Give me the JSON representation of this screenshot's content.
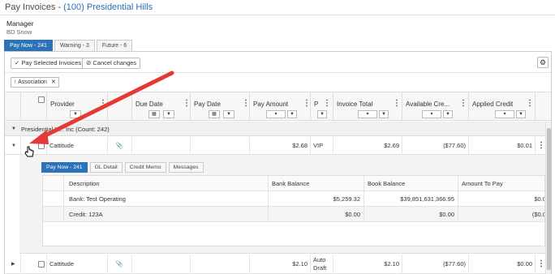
{
  "header": {
    "title_prefix": "Pay Invoices - ",
    "title_community": "(100) Presidential Hills"
  },
  "manager": {
    "label": "Manager",
    "name": "BD Snow"
  },
  "tabs": [
    {
      "label": "Pay Now - 241"
    },
    {
      "label": "Warning - 3"
    },
    {
      "label": "Future - 6"
    }
  ],
  "toolbar": {
    "pay_selected_label": "Pay Selected Invoices",
    "cancel_label": "Cancel changes"
  },
  "group_chip": {
    "label": "Association"
  },
  "columns": {
    "provider": "Provider",
    "due_date": "Due Date",
    "pay_date": "Pay Date",
    "pay_amount": "Pay Amount",
    "p": "P",
    "invoice_total": "Invoice Total",
    "available_credit": "Available Cre...",
    "applied_credit": "Applied Credit"
  },
  "group_row": {
    "label": "Presidential H... Inc (Count: 242)"
  },
  "rows": [
    {
      "provider": "Cattitude",
      "pay_amount": "$2.68",
      "p": "VIP",
      "invoice_total": "$2.69",
      "available_credit": "($77.60)",
      "applied_credit": "$0.01"
    },
    {
      "provider": "Cattitude",
      "pay_amount": "$2.10",
      "p_line1": "Auto",
      "p_line2": "Draft",
      "invoice_total": "$2.10",
      "available_credit": "($77.60)",
      "applied_credit": "$0.00"
    }
  ],
  "detail": {
    "tabs": [
      {
        "label": "Pay Now - 241"
      },
      {
        "label": "GL Detail"
      },
      {
        "label": "Credit Memo"
      },
      {
        "label": "Messages"
      }
    ],
    "columns": {
      "description": "Description",
      "bank_balance": "Bank Balance",
      "book_balance": "Book Balance",
      "amount_to_pay": "Amount To Pay"
    },
    "rows": [
      {
        "description": "Bank: Test Operating",
        "bank_balance": "$5,259.32",
        "book_balance": "$39,851,631,366.95",
        "amount_to_pay": "$0.0"
      },
      {
        "description": "Credit: 123A",
        "bank_balance": "$0.00",
        "book_balance": "$0.00",
        "amount_to_pay": "($0.0"
      }
    ]
  },
  "colors": {
    "accent": "#2a73b8",
    "arrow": "#e53935"
  }
}
